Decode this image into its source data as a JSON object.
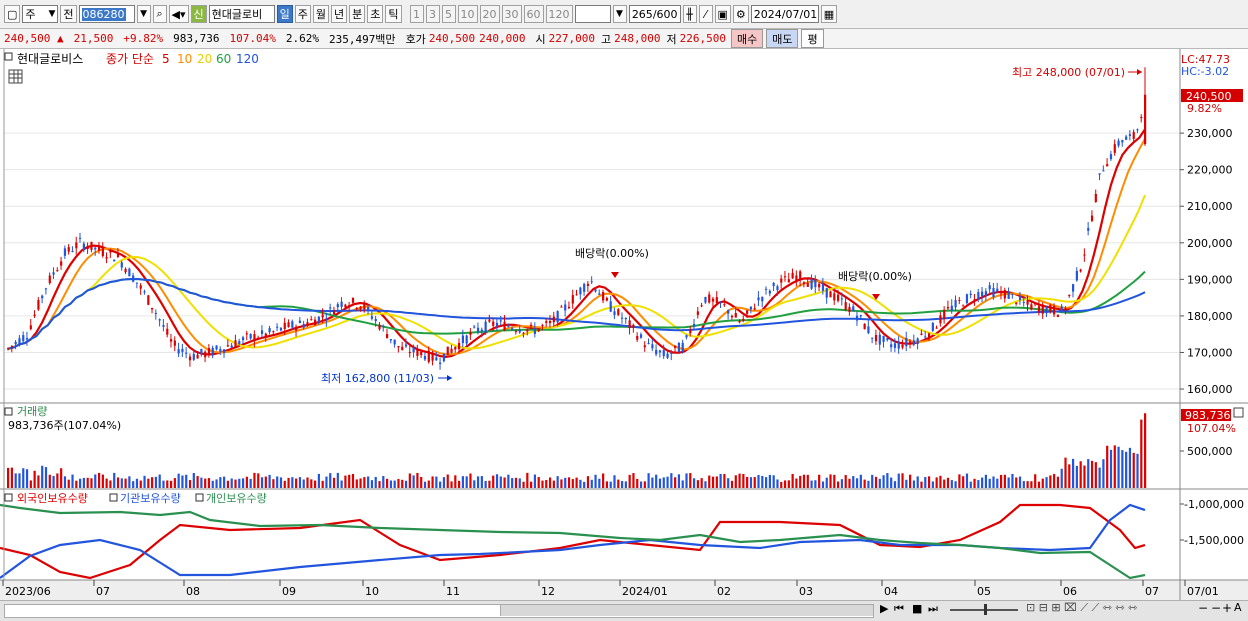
{
  "toolbar": {
    "period_type": "주",
    "prev_label": "전",
    "code": "086280",
    "sin_badge": "신",
    "name": "현대글로비",
    "periods": [
      "일",
      "주",
      "월",
      "년",
      "분",
      "초",
      "틱"
    ],
    "selected_period": "일",
    "intervals": [
      "1",
      "3",
      "5",
      "10",
      "20",
      "30",
      "60",
      "120"
    ],
    "count": "265",
    "count_max": "/600",
    "date": "2024/07/01"
  },
  "quote": {
    "price": "240,500",
    "change": "21,500",
    "rate": "+9.82%",
    "volume": "983,736",
    "volume_ratio": "107.04%",
    "turnover": "2.62%",
    "amount": "235,497백만",
    "ask_label": "호가",
    "ask": "240,500",
    "bid": "240,000",
    "open_label": "시",
    "open": "227,000",
    "high_label": "고",
    "high": "248,000",
    "low_label": "저",
    "low": "226,500",
    "buy_label": "매수",
    "sell_label": "매도",
    "eval_label": "평"
  },
  "chart": {
    "legend": {
      "name": "현대글로비스",
      "ma_label": "종가 단순",
      "periods": [
        "5",
        "10",
        "20",
        "60",
        "120"
      ],
      "colors": [
        "#dd0000",
        "#ff8c00",
        "#f0e000",
        "#20a040",
        "#2255dd"
      ]
    },
    "lc": "LC:47.73",
    "hc": "HC:-3.02",
    "price_ticks": [
      "230,000",
      "220,000",
      "210,000",
      "200,000",
      "190,000",
      "180,000",
      "170,000",
      "160,000"
    ],
    "current_price": "240,500",
    "current_rate": "9.82%",
    "high_annotation": "최고 248,000 (07/01)",
    "low_annotation": "최저 162,800 (11/03)",
    "dividend_annotations": [
      "배당락(0.00%)",
      "배당락(0.00%)"
    ],
    "volume": {
      "title": "거래량",
      "value_text": "983,736주(107.04%)",
      "tick": "500,000",
      "current": "983,736",
      "current_ratio": "107.04%"
    },
    "holdings": {
      "series": [
        "외국인보유수량",
        "기관보유수량",
        "개인보유수량"
      ],
      "colors": [
        "#dd0000",
        "#2255dd",
        "#2a9050"
      ],
      "ticks": [
        "-1,000,000",
        "-1,500,000"
      ]
    },
    "x_labels": [
      "2023/06",
      "07",
      "08",
      "09",
      "10",
      "11",
      "12",
      "2024/01",
      "02",
      "03",
      "04",
      "05",
      "06",
      "07",
      "07/01"
    ]
  },
  "chart_data": {
    "type": "candlestick",
    "x_range": [
      "2023/06",
      "2024/07/01"
    ],
    "y_range": [
      157000,
      250000
    ],
    "price_path": [
      [
        0,
        171000
      ],
      [
        10,
        175000
      ],
      [
        20,
        188000
      ],
      [
        30,
        197000
      ],
      [
        38,
        200000
      ],
      [
        48,
        198000
      ],
      [
        58,
        196000
      ],
      [
        67,
        190000
      ],
      [
        77,
        182000
      ],
      [
        87,
        172000
      ],
      [
        97,
        169000
      ],
      [
        107,
        170000
      ],
      [
        117,
        172000
      ],
      [
        127,
        174000
      ],
      [
        137,
        175000
      ],
      [
        147,
        177000
      ],
      [
        157,
        178000
      ],
      [
        167,
        180000
      ],
      [
        177,
        184000
      ],
      [
        187,
        183000
      ],
      [
        197,
        177000
      ],
      [
        207,
        171000
      ],
      [
        217,
        170000
      ],
      [
        227,
        168000
      ],
      [
        237,
        172000
      ],
      [
        247,
        176000
      ],
      [
        257,
        178000
      ],
      [
        267,
        177000
      ],
      [
        277,
        176000
      ],
      [
        287,
        178000
      ],
      [
        297,
        184000
      ],
      [
        307,
        190000
      ],
      [
        317,
        183000
      ],
      [
        327,
        178000
      ],
      [
        337,
        172000
      ],
      [
        347,
        169000
      ],
      [
        357,
        172000
      ],
      [
        367,
        185000
      ],
      [
        377,
        183000
      ],
      [
        387,
        178000
      ],
      [
        397,
        185000
      ],
      [
        407,
        189000
      ],
      [
        417,
        191000
      ],
      [
        427,
        188000
      ],
      [
        437,
        185000
      ],
      [
        447,
        181000
      ],
      [
        457,
        174000
      ],
      [
        467,
        172000
      ],
      [
        477,
        173000
      ],
      [
        487,
        176000
      ],
      [
        497,
        182000
      ],
      [
        507,
        185000
      ],
      [
        517,
        187000
      ],
      [
        527,
        186000
      ],
      [
        537,
        183000
      ],
      [
        547,
        182000
      ],
      [
        557,
        181000
      ],
      [
        567,
        195000
      ],
      [
        577,
        220000
      ],
      [
        587,
        228000
      ],
      [
        595,
        229000
      ],
      [
        600,
        240500
      ]
    ],
    "volume_spikes": {
      "first_week_max": 983736,
      "last_bar": 983736
    }
  }
}
